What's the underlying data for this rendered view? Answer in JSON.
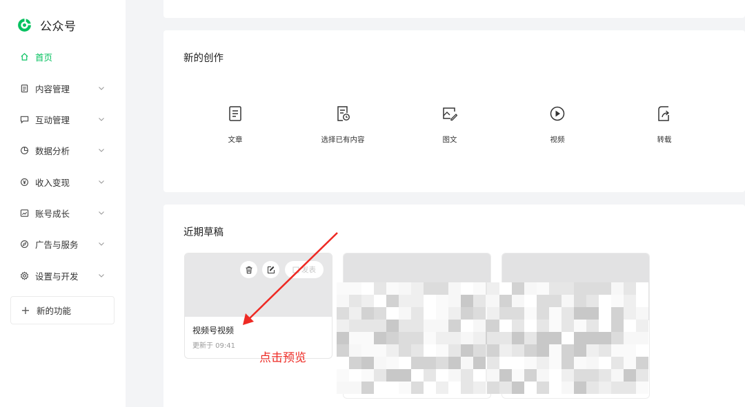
{
  "app": {
    "title": "公众号",
    "brand_color": "#07c160"
  },
  "sidebar": {
    "items": [
      {
        "label": "首页",
        "icon": "home-icon",
        "active": true
      },
      {
        "label": "内容管理",
        "icon": "document-icon"
      },
      {
        "label": "互动管理",
        "icon": "chat-icon"
      },
      {
        "label": "数据分析",
        "icon": "pie-chart-icon"
      },
      {
        "label": "收入变现",
        "icon": "yen-icon"
      },
      {
        "label": "账号成长",
        "icon": "growth-chart-icon"
      },
      {
        "label": "广告与服务",
        "icon": "compass-icon"
      },
      {
        "label": "设置与开发",
        "icon": "gear-icon"
      }
    ],
    "new_feature": "新的功能"
  },
  "create": {
    "title": "新的创作",
    "items": [
      {
        "label": "文章",
        "icon": "article-icon"
      },
      {
        "label": "选择已有内容",
        "icon": "existing-content-icon"
      },
      {
        "label": "图文",
        "icon": "image-text-icon"
      },
      {
        "label": "视频",
        "icon": "video-play-icon"
      },
      {
        "label": "转载",
        "icon": "repost-icon"
      }
    ]
  },
  "drafts": {
    "title": "近期草稿",
    "items": [
      {
        "title": "视频号视频",
        "time": "更新于 09:41",
        "publish_label": "发表"
      }
    ]
  },
  "annotation": {
    "text": "点击预览",
    "color": "#ee2a24"
  }
}
